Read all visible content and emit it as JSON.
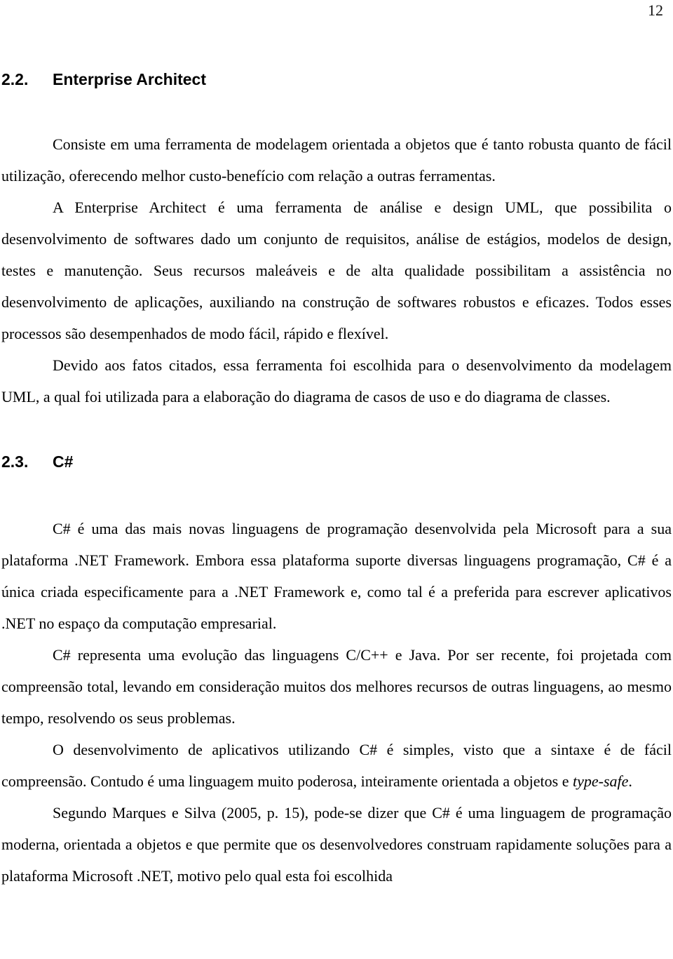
{
  "document": {
    "page_number": "12",
    "language": "pt-BR"
  },
  "sections": [
    {
      "number": "2.2.",
      "title": "Enterprise Architect",
      "paragraphs": [
        "Consiste em uma ferramenta de modelagem orientada a objetos que é tanto robusta quanto de fácil utilização, oferecendo melhor custo-benefício com relação a outras ferramentas.",
        "A Enterprise Architect é uma ferramenta de análise e design UML, que possibilita o desenvolvimento de softwares dado um conjunto de requisitos, análise de estágios, modelos de design, testes e manutenção. Seus recursos maleáveis e de alta qualidade possibilitam a assistência no desenvolvimento de aplicações, auxiliando na construção de softwares robustos e eficazes. Todos esses processos são desempenhados de modo fácil, rápido e flexível.",
        "Devido aos fatos citados, essa ferramenta foi escolhida para o desenvolvimento da modelagem UML, a qual foi utilizada para a elaboração do diagrama de casos de uso e do diagrama de classes."
      ]
    },
    {
      "number": "2.3.",
      "title": "C#",
      "paragraphs": [
        "C# é uma das mais novas linguagens de programação desenvolvida pela Microsoft para a sua plataforma .NET Framework. Embora essa plataforma suporte diversas linguagens programação, C# é a única criada especificamente para a .NET Framework e, como tal é  a preferida para escrever aplicativos .NET no espaço da computação empresarial.",
        "C# representa uma evolução das linguagens C/C++ e Java. Por ser recente, foi projetada com compreensão total, levando em consideração muitos dos melhores recursos de outras linguagens, ao mesmo tempo, resolvendo os seus problemas."
      ],
      "paragraph_with_italic": {
        "before": "O desenvolvimento de aplicativos utilizando C# é simples, visto que a sintaxe é de fácil compreensão. Contudo é uma linguagem muito poderosa, inteiramente orientada a objetos e ",
        "italic": "type-safe",
        "after": "."
      },
      "final_paragraph": "Segundo Marques e Silva (2005, p. 15), pode-se dizer que C# é uma linguagem de programação moderna, orientada a objetos e que permite que os desenvolvedores construam rapidamente soluções para a plataforma Microsoft .NET, motivo pelo qual esta foi escolhida"
    }
  ]
}
